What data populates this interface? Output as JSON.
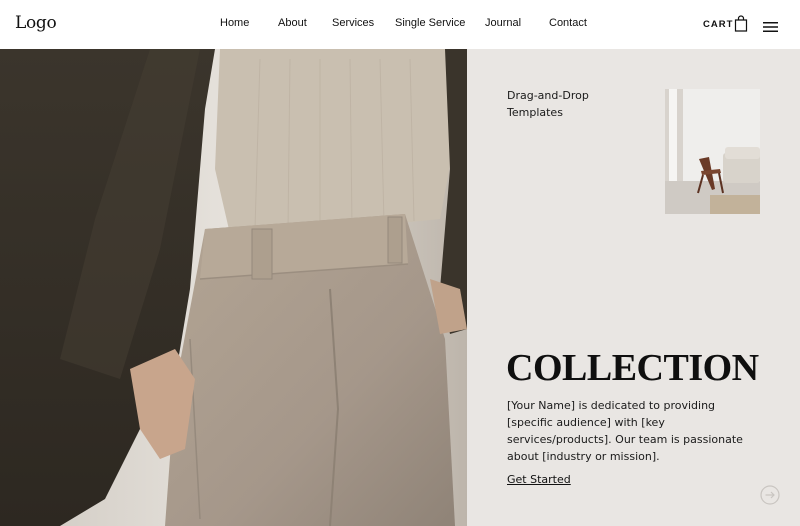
{
  "header": {
    "logo": "Logo",
    "nav": [
      "Home",
      "About",
      "Services",
      "Single Service",
      "Journal",
      "Contact"
    ],
    "cart_label": "CART"
  },
  "panel": {
    "feature_label": "Drag-and-Drop Templates",
    "title": "COLLECTION",
    "description": "[Your Name] is dedicated to providing [specific audience] with [key services/products]. Our team is passionate about [industry or mission].",
    "cta_label": "Get Started"
  },
  "icons": [
    "bag-icon",
    "hamburger-menu-icon",
    "arrow-circle-right-icon"
  ],
  "colors": {
    "panel_background": "#e9e6e3",
    "header_background": "#ffffff",
    "text": "#1a1a1a"
  }
}
